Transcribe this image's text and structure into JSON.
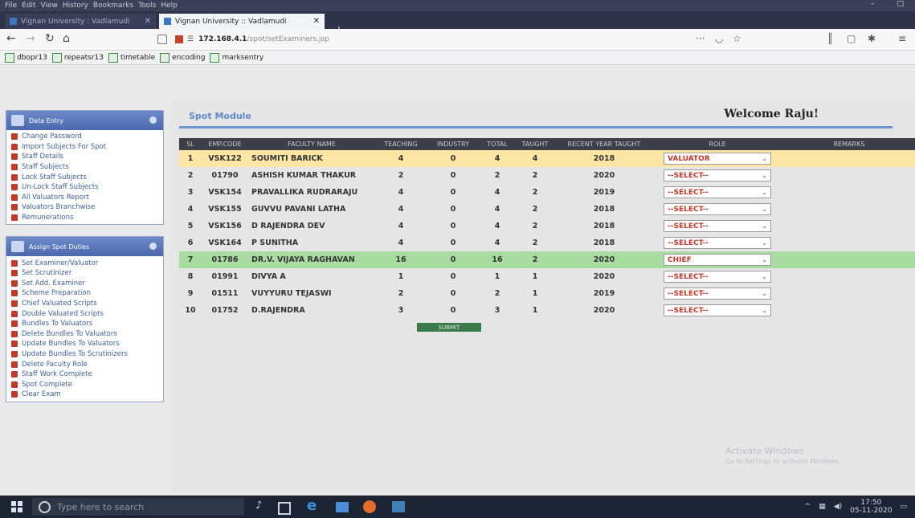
{
  "browser": {
    "menu": [
      "File",
      "Edit",
      "View",
      "History",
      "Bookmarks",
      "Tools",
      "Help"
    ],
    "window_controls": [
      "–",
      "□"
    ],
    "tabs": [
      {
        "title": "Vignan University : Vadlamudi",
        "active": false
      },
      {
        "title": "Vignan University :: Vadlamudi",
        "active": true
      }
    ],
    "new_tab": "+",
    "url_host": "172.168.4.1",
    "url_path": "/spot/setExaminers.jsp",
    "url_menu": "···",
    "bookmarks": [
      "dbopr13",
      "repeatsr13",
      "timetable",
      "encoding",
      "marksentry"
    ]
  },
  "sidebar": {
    "data_entry": {
      "title": "Data Entry",
      "items": [
        "Change Password",
        "Import Subjects For Spot",
        "Staff Details",
        "Staff Subjects",
        "Lock Staff Subjects",
        "Un-Lock Staff Subjects",
        "All Valuators Report",
        "Valuators Branchwise",
        "Remunerations"
      ]
    },
    "assign_spot_duties": {
      "title": "Assign Spot Duties",
      "items": [
        "Set Examiner/Valuator",
        "Set Scrutinizer",
        "Set Add. Examiner",
        "Scheme Preparation",
        "Chief Valuated Scripts",
        "Double Valuated Scripts",
        "Bundles To Valuators",
        "Delete Bundles To Valuators",
        "Update Bundles To Valuators",
        "Update Bundles To Scrutinizers",
        "Delete Faculty Role",
        "Staff Work Complete",
        "Spot Complete",
        "Clear Exam"
      ]
    }
  },
  "main": {
    "module_title": "Spot Module",
    "welcome": "Welcome Raju!",
    "columns": [
      "SL",
      "EMP.CODE",
      "FACULTY NAME",
      "TEACHING",
      "INDUSTRY",
      "TOTAL",
      "TAUGHT",
      "RECENT YEAR TAUGHT",
      "ROLE",
      "REMARKS"
    ],
    "rows": [
      {
        "sl": "1",
        "emp_code": "VSK122",
        "name": "SOUMITI BARICK",
        "teaching": "4",
        "industry": "0",
        "total": "4",
        "taught": "4",
        "recent_year": "2018",
        "role": "VALUATOR",
        "highlight": "yellow"
      },
      {
        "sl": "2",
        "emp_code": "01790",
        "name": "ASHISH KUMAR THAKUR",
        "teaching": "2",
        "industry": "0",
        "total": "2",
        "taught": "2",
        "recent_year": "2020",
        "role": "--SELECT--",
        "highlight": ""
      },
      {
        "sl": "3",
        "emp_code": "VSK154",
        "name": "PRAVALLIKA RUDRARAJU",
        "teaching": "4",
        "industry": "0",
        "total": "4",
        "taught": "2",
        "recent_year": "2019",
        "role": "--SELECT--",
        "highlight": ""
      },
      {
        "sl": "4",
        "emp_code": "VSK155",
        "name": "GUVVU PAVANI LATHA",
        "teaching": "4",
        "industry": "0",
        "total": "4",
        "taught": "2",
        "recent_year": "2018",
        "role": "--SELECT--",
        "highlight": ""
      },
      {
        "sl": "5",
        "emp_code": "VSK156",
        "name": "D RAJENDRA DEV",
        "teaching": "4",
        "industry": "0",
        "total": "4",
        "taught": "2",
        "recent_year": "2018",
        "role": "--SELECT--",
        "highlight": ""
      },
      {
        "sl": "6",
        "emp_code": "VSK164",
        "name": "P SUNITHA",
        "teaching": "4",
        "industry": "0",
        "total": "4",
        "taught": "2",
        "recent_year": "2018",
        "role": "--SELECT--",
        "highlight": ""
      },
      {
        "sl": "7",
        "emp_code": "01786",
        "name": "DR.V. VIJAYA RAGHAVAN",
        "teaching": "16",
        "industry": "0",
        "total": "16",
        "taught": "2",
        "recent_year": "2020",
        "role": "CHIEF",
        "highlight": "green"
      },
      {
        "sl": "8",
        "emp_code": "01991",
        "name": "DIVYA A",
        "teaching": "1",
        "industry": "0",
        "total": "1",
        "taught": "1",
        "recent_year": "2020",
        "role": "--SELECT--",
        "highlight": ""
      },
      {
        "sl": "9",
        "emp_code": "01511",
        "name": "VUYYURU TEJASWI",
        "teaching": "2",
        "industry": "0",
        "total": "2",
        "taught": "1",
        "recent_year": "2019",
        "role": "--SELECT--",
        "highlight": ""
      },
      {
        "sl": "10",
        "emp_code": "01752",
        "name": "D.RAJENDRA",
        "teaching": "3",
        "industry": "0",
        "total": "3",
        "taught": "1",
        "recent_year": "2020",
        "role": "--SELECT--",
        "highlight": ""
      }
    ],
    "submit_label": "SUBMIT",
    "activate_title": "Activate Windows",
    "activate_sub": "Go to Settings to activate Windows."
  },
  "taskbar": {
    "search_placeholder": "Type here to search",
    "time": "17:50",
    "date": "05-11-2020"
  },
  "colors": {
    "highlight_yellow": "#fbe6a6",
    "highlight_green": "#a9dca0",
    "role_text": "#c0392b",
    "accent_blue": "#6f93cf"
  }
}
